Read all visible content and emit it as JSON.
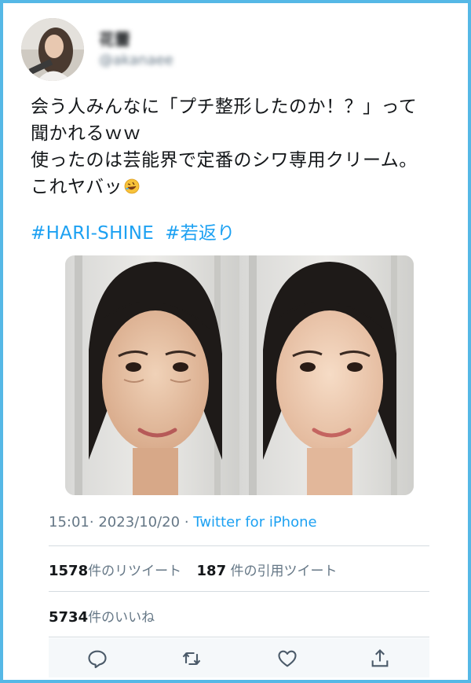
{
  "user": {
    "display_name": "花蕾",
    "handle": "@akanaee"
  },
  "tweet": {
    "lines": [
      "会う人みんなに「プチ整形したのか！？」って",
      "聞かれるｗｗ",
      "使ったのは芸能界で定番のシワ専用クリーム。",
      "これヤバッ"
    ],
    "emoji": "rolling-on-floor-laughing-emoji",
    "hashtags": [
      "#HARI-SHINE",
      "#若返り"
    ]
  },
  "meta": {
    "time": "15:01",
    "sep1": "·",
    "date": "2023/10/20",
    "sep2": "·",
    "source": "Twitter for iPhone"
  },
  "stats": {
    "retweets_count": "1578",
    "retweets_label": "件のリツイート",
    "quotes_count": "187",
    "quotes_label": "件の引用ツイート",
    "likes_count": "5734",
    "likes_label": "件のいいね"
  },
  "actions": {
    "reply_icon": "reply-icon",
    "retweet_icon": "retweet-icon",
    "like_icon": "heart-icon",
    "share_icon": "share-icon"
  },
  "colors": {
    "border": "#55b8e6",
    "link": "#1da1f2",
    "muted": "#657786",
    "text": "#14171a"
  }
}
